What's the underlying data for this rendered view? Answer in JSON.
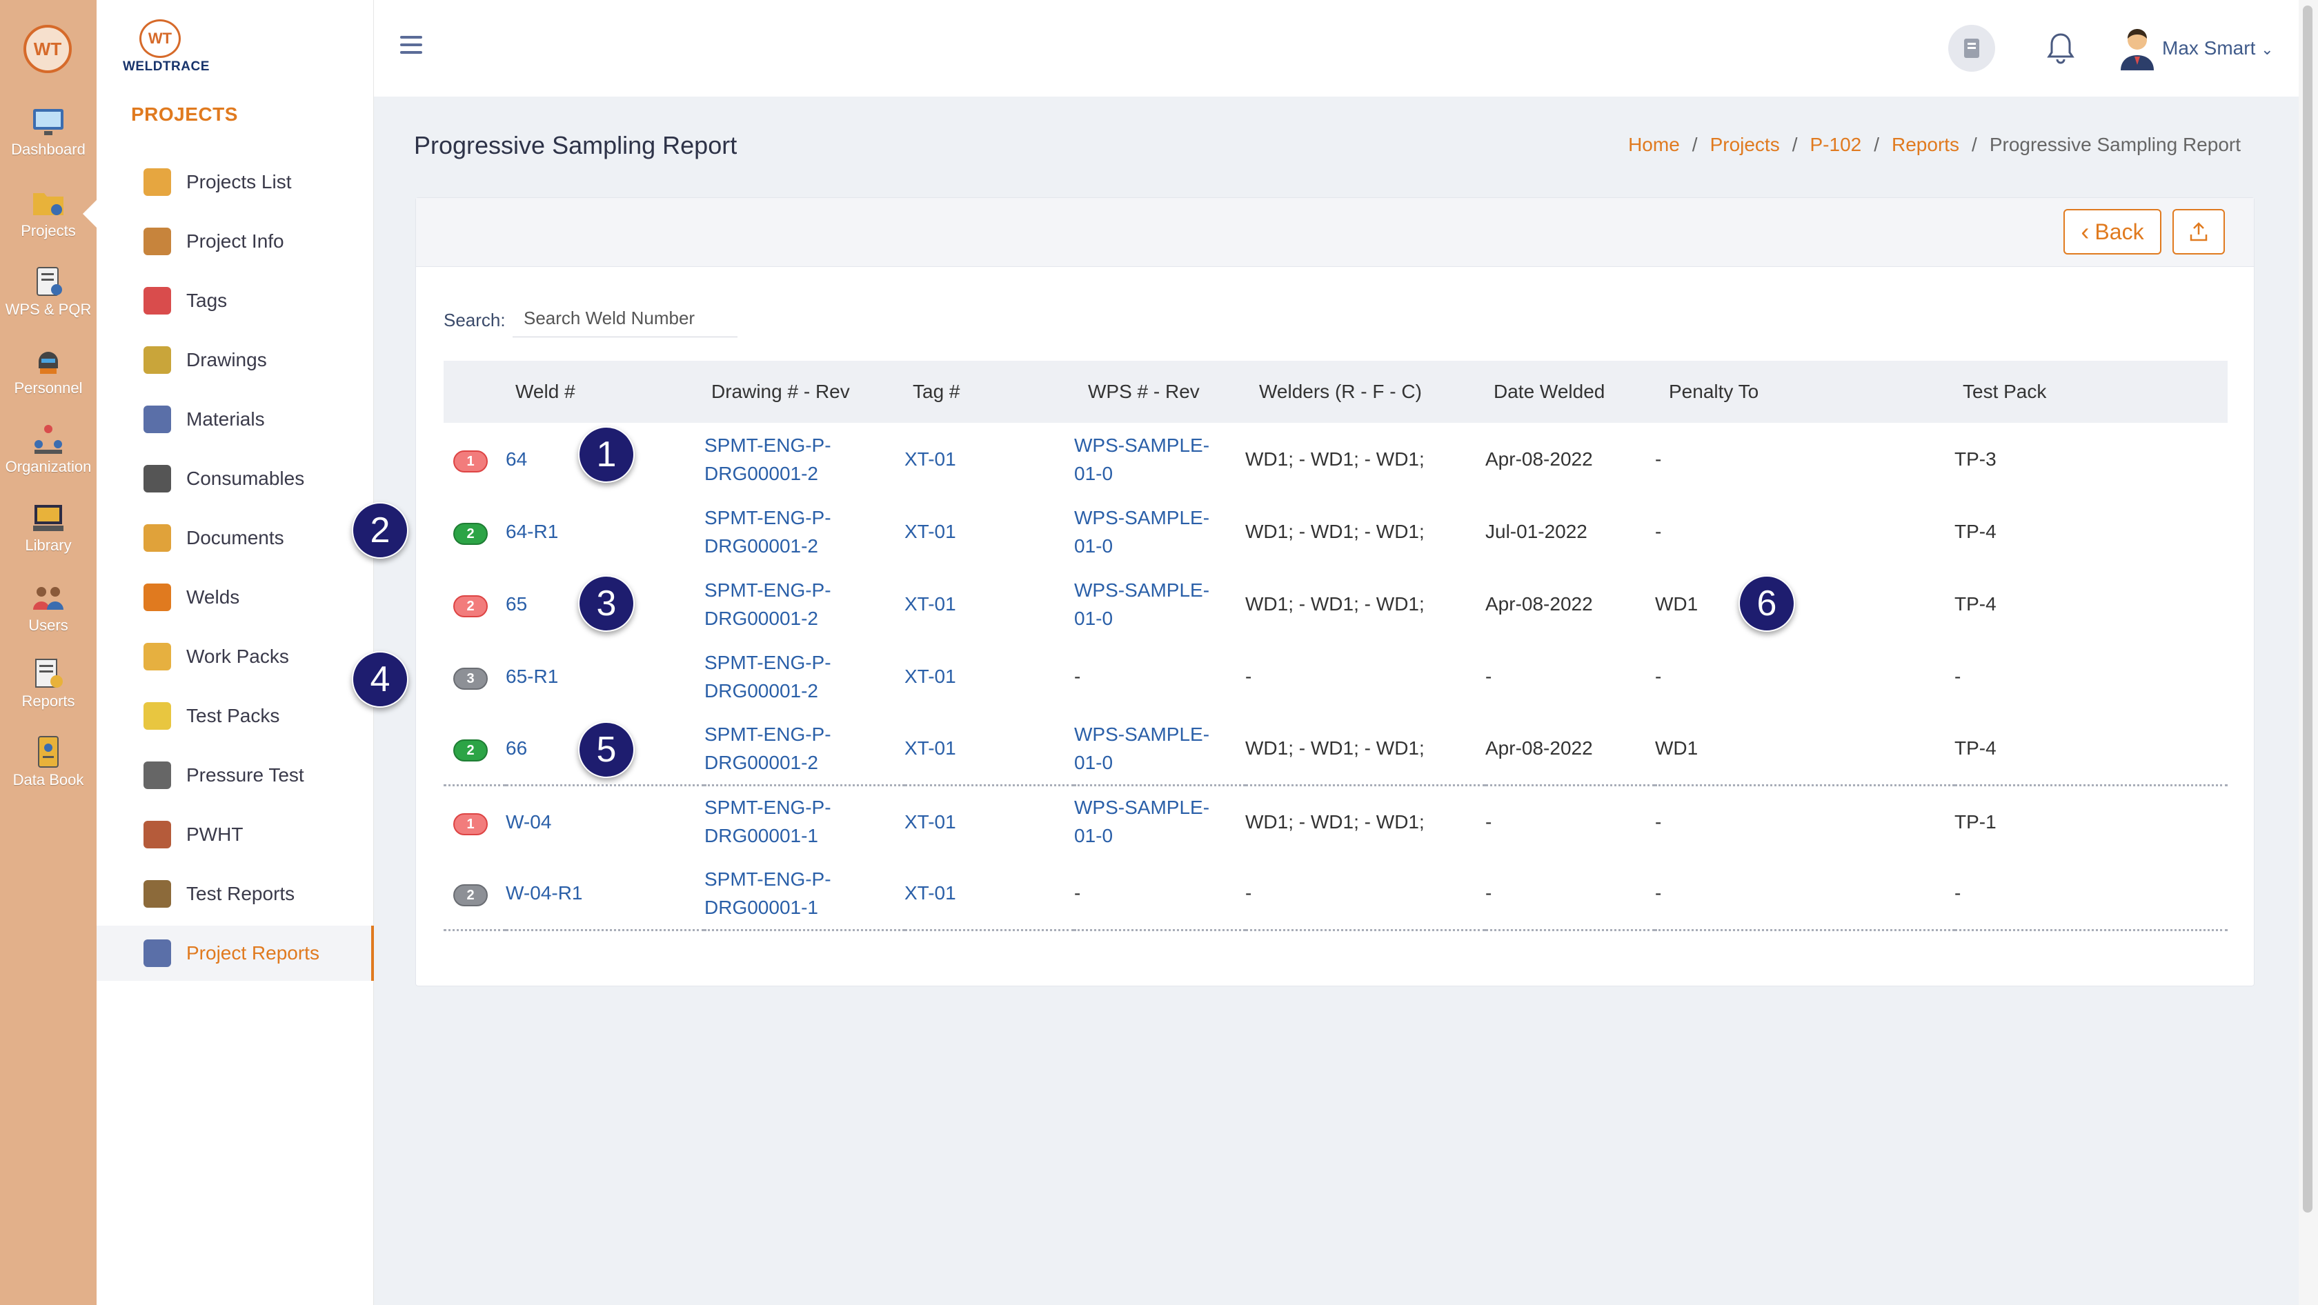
{
  "rail": {
    "logo": "WT",
    "items": [
      {
        "label": "Dashboard",
        "icon": "dashboard-monitor-icon"
      },
      {
        "label": "Projects",
        "icon": "projects-folder-icon"
      },
      {
        "label": "WPS & PQR",
        "icon": "wps-clipboard-icon"
      },
      {
        "label": "Personnel",
        "icon": "welder-helmet-icon"
      },
      {
        "label": "Organization",
        "icon": "organization-icon"
      },
      {
        "label": "Library",
        "icon": "library-icon"
      },
      {
        "label": "Users",
        "icon": "users-icon"
      },
      {
        "label": "Reports",
        "icon": "reports-icon"
      },
      {
        "label": "Data Book",
        "icon": "data-book-icon"
      }
    ]
  },
  "brand": {
    "mark": "WT",
    "name": "WELDTRACE"
  },
  "subnav": {
    "heading": "PROJECTS",
    "items": [
      {
        "label": "Projects List",
        "color": "#e6a640"
      },
      {
        "label": "Project Info",
        "color": "#c7843c"
      },
      {
        "label": "Tags",
        "color": "#d94c4c"
      },
      {
        "label": "Drawings",
        "color": "#c9a53a"
      },
      {
        "label": "Materials",
        "color": "#5a6fa8"
      },
      {
        "label": "Consumables",
        "color": "#555555"
      },
      {
        "label": "Documents",
        "color": "#e0a23a"
      },
      {
        "label": "Welds",
        "color": "#e07a1f"
      },
      {
        "label": "Work Packs",
        "color": "#e6b040"
      },
      {
        "label": "Test Packs",
        "color": "#e8c640"
      },
      {
        "label": "Pressure Test",
        "color": "#666666"
      },
      {
        "label": "PWHT",
        "color": "#b55b3a"
      },
      {
        "label": "Test Reports",
        "color": "#8c6a3a"
      },
      {
        "label": "Project Reports",
        "color": "#5a6fa8"
      }
    ]
  },
  "header": {
    "user_name": "Max Smart",
    "user_caret": "⌄"
  },
  "page": {
    "title": "Progressive Sampling Report",
    "breadcrumb": [
      "Home",
      "Projects",
      "P-102",
      "Reports"
    ],
    "breadcrumb_current": "Progressive Sampling Report",
    "back_label": "Back",
    "back_chevron": "‹",
    "search_label": "Search:",
    "search_placeholder": "Search Weld Number"
  },
  "table": {
    "headers": [
      "Weld #",
      "Drawing # - Rev",
      "Tag #",
      "WPS # - Rev",
      "Welders (R - F - C)",
      "Date Welded",
      "Penalty To",
      "Test Pack"
    ],
    "rows": [
      {
        "badge": "1",
        "badge_color": "red",
        "weld": "64",
        "drawing_1": "SPMT-ENG-P-",
        "drawing_2": "DRG00001-2",
        "tag": "XT-01",
        "wps_1": "WPS-SAMPLE-",
        "wps_2": "01-0",
        "welders": "WD1; - WD1; - WD1;",
        "date": "Apr-08-2022",
        "penalty": "-",
        "test_pack": "TP-3"
      },
      {
        "badge": "2",
        "badge_color": "green",
        "weld": "64-R1",
        "drawing_1": "SPMT-ENG-P-",
        "drawing_2": "DRG00001-2",
        "tag": "XT-01",
        "wps_1": "WPS-SAMPLE-",
        "wps_2": "01-0",
        "welders": "WD1; - WD1; - WD1;",
        "date": "Jul-01-2022",
        "penalty": "-",
        "test_pack": "TP-4"
      },
      {
        "badge": "2",
        "badge_color": "red",
        "weld": "65",
        "drawing_1": "SPMT-ENG-P-",
        "drawing_2": "DRG00001-2",
        "tag": "XT-01",
        "wps_1": "WPS-SAMPLE-",
        "wps_2": "01-0",
        "welders": "WD1; - WD1; - WD1;",
        "date": "Apr-08-2022",
        "penalty": "WD1",
        "test_pack": "TP-4"
      },
      {
        "badge": "3",
        "badge_color": "gray",
        "weld": "65-R1",
        "drawing_1": "SPMT-ENG-P-",
        "drawing_2": "DRG00001-2",
        "tag": "XT-01",
        "wps_1": "-",
        "wps_2": "",
        "welders": "-",
        "date": "-",
        "penalty": "-",
        "test_pack": "-"
      },
      {
        "badge": "2",
        "badge_color": "green",
        "weld": "66",
        "drawing_1": "SPMT-ENG-P-",
        "drawing_2": "DRG00001-2",
        "tag": "XT-01",
        "wps_1": "WPS-SAMPLE-",
        "wps_2": "01-0",
        "welders": "WD1; - WD1; - WD1;",
        "date": "Apr-08-2022",
        "penalty": "WD1",
        "test_pack": "TP-4"
      },
      {
        "badge": "1",
        "badge_color": "red",
        "weld": "W-04",
        "drawing_1": "SPMT-ENG-P-",
        "drawing_2": "DRG00001-1",
        "tag": "XT-01",
        "wps_1": "WPS-SAMPLE-",
        "wps_2": "01-0",
        "welders": "WD1; - WD1; - WD1;",
        "date": "-",
        "penalty": "-",
        "test_pack": "TP-1"
      },
      {
        "badge": "2",
        "badge_color": "gray",
        "weld": "W-04-R1",
        "drawing_1": "SPMT-ENG-P-",
        "drawing_2": "DRG00001-1",
        "tag": "XT-01",
        "wps_1": "-",
        "wps_2": "",
        "welders": "-",
        "date": "-",
        "penalty": "-",
        "test_pack": "-"
      }
    ]
  },
  "callouts": [
    "1",
    "2",
    "3",
    "4",
    "5",
    "6"
  ],
  "colors": {
    "accent": "#e07a1f",
    "link": "#2a5fa8",
    "rail": "#e2b08a",
    "callout": "#1e1d6f"
  }
}
